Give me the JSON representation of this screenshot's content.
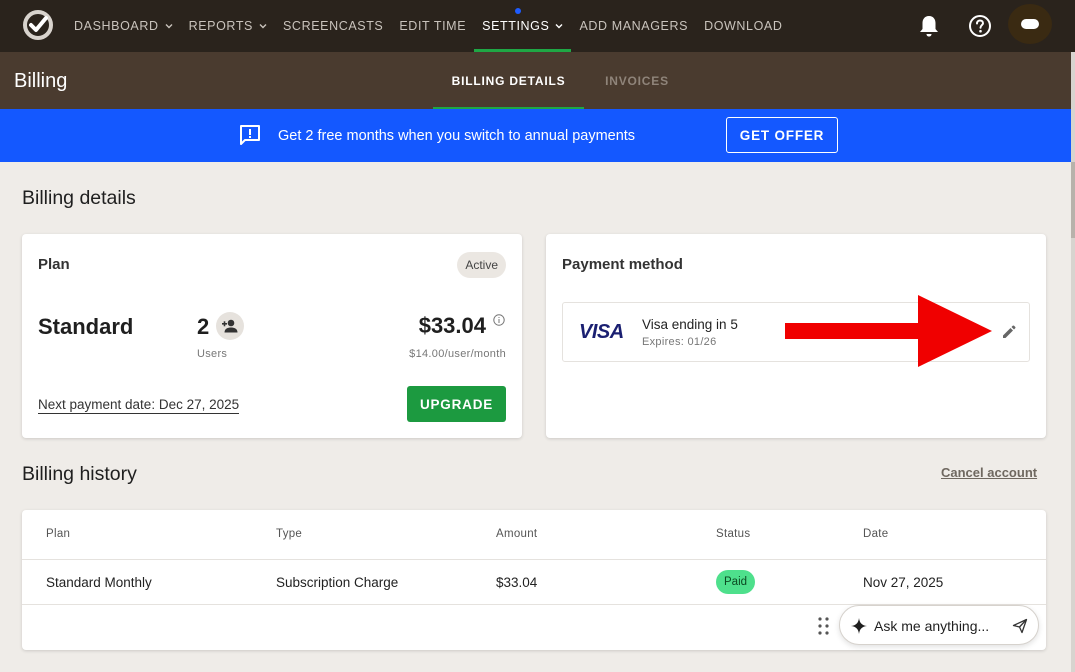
{
  "nav": {
    "items": [
      {
        "label": "DASHBOARD",
        "dropdown": true
      },
      {
        "label": "REPORTS",
        "dropdown": true
      },
      {
        "label": "SCREENCASTS",
        "dropdown": false
      },
      {
        "label": "EDIT TIME",
        "dropdown": false
      },
      {
        "label": "SETTINGS",
        "dropdown": true,
        "active": true
      },
      {
        "label": "ADD MANAGERS",
        "dropdown": false
      },
      {
        "label": "DOWNLOAD",
        "dropdown": false
      }
    ],
    "icons": [
      "logo-icon",
      "bell-icon",
      "help-icon",
      "avatar"
    ]
  },
  "subheader": {
    "title": "Billing",
    "tabs": [
      {
        "label": "BILLING DETAILS",
        "active": true
      },
      {
        "label": "INVOICES",
        "active": false
      }
    ]
  },
  "promo": {
    "text": "Get 2 free months when you switch to annual payments",
    "button": "GET OFFER"
  },
  "billing_details": {
    "title": "Billing details",
    "plan": {
      "label": "Plan",
      "status": "Active",
      "name": "Standard",
      "users_count": "2",
      "users_label": "Users",
      "price": "$33.04",
      "per_user": "$14.00/user/month",
      "next_payment": "Next payment date: Dec 27, 2025",
      "upgrade_button": "UPGRADE"
    },
    "payment": {
      "label": "Payment method",
      "card_brand": "VISA",
      "card_text": "Visa ending in",
      "card_digit": "5",
      "expires": "Expires: 01/26"
    }
  },
  "billing_history": {
    "title": "Billing history",
    "cancel_link": "Cancel account",
    "columns": [
      "Plan",
      "Type",
      "Amount",
      "Status",
      "Date"
    ],
    "rows": [
      {
        "plan": "Standard Monthly",
        "type": "Subscription Charge",
        "amount": "$33.04",
        "status": "Paid",
        "date": "Nov 27, 2025"
      }
    ]
  },
  "assistant": {
    "placeholder": "Ask me anything..."
  },
  "colors": {
    "nav_bg": "#2a231c",
    "subheader_bg": "#4a3b2f",
    "promo_bg": "#1458ff",
    "accent_green": "#1c9a40",
    "paid_badge": "#4ee08c",
    "arrow": "#f00000"
  }
}
